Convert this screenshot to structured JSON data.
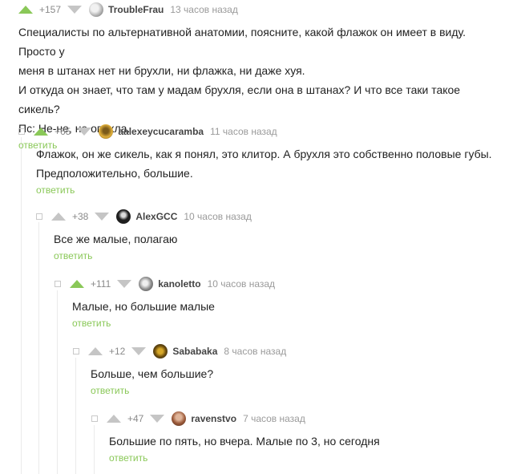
{
  "colors": {
    "accent": "#8ac858",
    "muted": "#c5c5c5",
    "reply": "#8ac858"
  },
  "comments": [
    {
      "rating": "+157",
      "user": "TroubleFrau",
      "time": "13 часов назад",
      "lines": [
        "Специалисты по альтернативной анатомии, поясните, какой флажок он имеет в виду. Просто у",
        "меня в штанах нет ни брухли, ни флажка, ни даже хуя.",
        "И откуда он знает, что там у мадам брухля, если она в штанах? И что все таки такое сикель?",
        "Пс: Не-не, не опухла."
      ],
      "reply": "ответить"
    },
    {
      "rating": "+65",
      "user": "aalexeycucaramba",
      "time": "11 часов назад",
      "lines": [
        "Флажок, он же сикель, как я понял, это клитор. А брухля это собственно половые губы.",
        "Предположительно, большие."
      ],
      "reply": "ответить"
    },
    {
      "rating": "+38",
      "user": "AlexGCC",
      "time": "10 часов назад",
      "lines": [
        "Все же малые, полагаю"
      ],
      "reply": "ответить"
    },
    {
      "rating": "+111",
      "user": "kanoletto",
      "time": "10 часов назад",
      "lines": [
        "Малые, но большие малые"
      ],
      "reply": "ответить"
    },
    {
      "rating": "+12",
      "user": "Sababaka",
      "time": "8 часов назад",
      "lines": [
        "Больше, чем большие?"
      ],
      "reply": "ответить"
    },
    {
      "rating": "+47",
      "user": "ravenstvo",
      "time": "7 часов назад",
      "lines": [
        "Большие по пять, но вчера. Малые по 3, но сегодня"
      ],
      "reply": "ответить"
    }
  ]
}
